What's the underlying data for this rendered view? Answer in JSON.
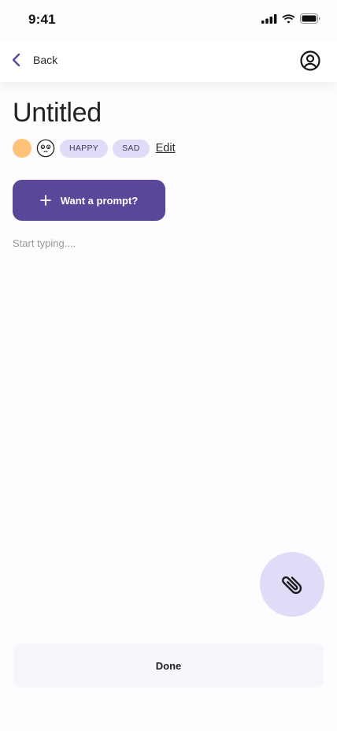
{
  "status_bar": {
    "time": "9:41"
  },
  "nav": {
    "back_label": "Back",
    "back_icon": "chevron-left-icon",
    "profile_icon": "user-circle-icon"
  },
  "entry": {
    "title": "Untitled",
    "mood_color": "#fec27b",
    "mood_icon": "neutral-face-icon",
    "tags": [
      "HAPPY",
      "SAD"
    ],
    "edit_label": "Edit"
  },
  "prompt_button": {
    "label": "Want a prompt?",
    "icon": "plus-icon"
  },
  "editor": {
    "placeholder": "Start typing...."
  },
  "attach_button": {
    "icon": "paperclip-icon"
  },
  "done_button": {
    "label": "Done"
  },
  "colors": {
    "primary": "#5a4799",
    "chip_bg": "#e0dcf8",
    "accent_back": "#5a4799"
  }
}
